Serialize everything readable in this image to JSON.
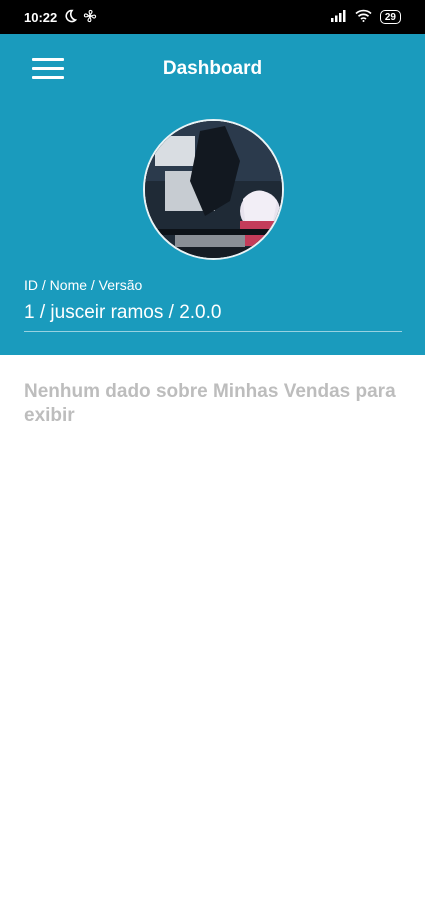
{
  "status_bar": {
    "time": "10:22",
    "battery": "29",
    "icons": [
      "moon-icon",
      "fan-icon",
      "signal-icon",
      "wifi-icon",
      "battery-icon"
    ]
  },
  "header": {
    "title": "Dashboard",
    "menu_icon": "hamburger-menu-icon",
    "bg_color": "#1a9bbd"
  },
  "profile": {
    "id_label": "ID / Nome / Versão",
    "id_value": "1 / jusceir ramos / 2.0.0"
  },
  "main": {
    "empty_message": "Nenhum dado sobre Minhas Vendas para exibir"
  }
}
